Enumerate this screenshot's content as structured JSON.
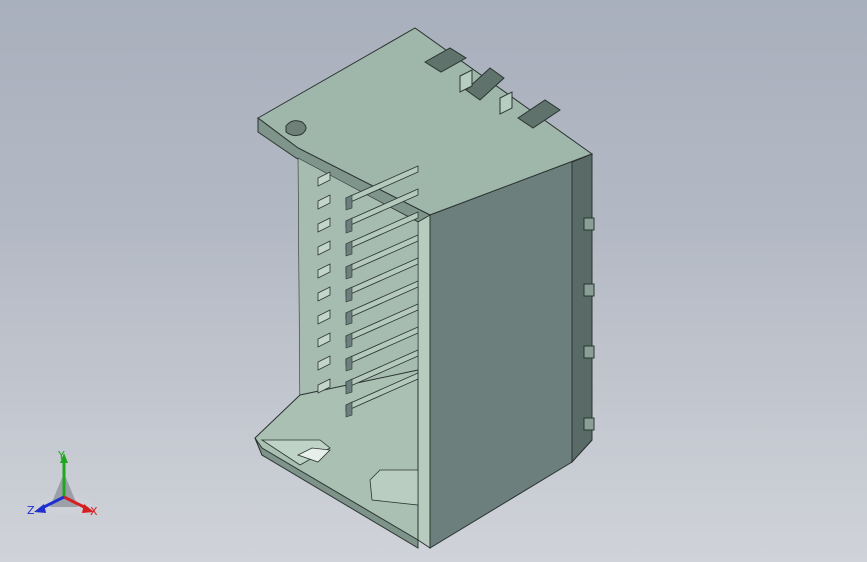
{
  "viewport": {
    "background_top": "#a9b0bd",
    "background_bottom": "#d0d3d9"
  },
  "model": {
    "part_type": "connector-housing",
    "face_colors": {
      "top": "#9db5a8",
      "front": "#6b7c7a",
      "inner": "#a8bfb2",
      "dark": "#4e5d5b",
      "edge": "#2b3431"
    },
    "pin_count": 9
  },
  "triad": {
    "y_label": "Y",
    "z_label": "Z",
    "x_label": "X",
    "y_color": "#1fa81f",
    "x_color": "#d42020",
    "z_color": "#2030d0"
  }
}
